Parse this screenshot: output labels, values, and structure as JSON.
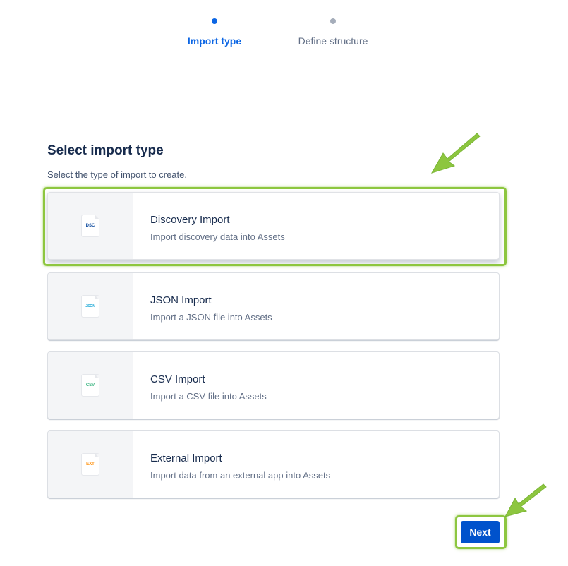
{
  "stepper": {
    "steps": [
      {
        "label": "Import type",
        "state": "active"
      },
      {
        "label": "Define structure",
        "state": "inactive"
      }
    ]
  },
  "header": {
    "title": "Select import type",
    "subtitle": "Select the type of import to create."
  },
  "import_types": [
    {
      "icon": "dsc-file-icon",
      "icon_text": "DSC",
      "icon_color": "#0c4a9e",
      "name": "Discovery Import",
      "description": "Import discovery data into Assets",
      "selected": true
    },
    {
      "icon": "json-file-icon",
      "icon_text": "JSON",
      "icon_color": "#1aa7d6",
      "name": "JSON Import",
      "description": "Import a JSON file into Assets",
      "selected": false
    },
    {
      "icon": "csv-file-icon",
      "icon_text": "CSV",
      "icon_color": "#36b37e",
      "name": "CSV Import",
      "description": "Import a CSV file into Assets",
      "selected": false
    },
    {
      "icon": "ext-file-icon",
      "icon_text": "EXT",
      "icon_color": "#ff8b00",
      "name": "External Import",
      "description": "Import data from an external app into Assets",
      "selected": false
    }
  ],
  "actions": {
    "next_label": "Next"
  },
  "colors": {
    "accent": "#0c66e4",
    "button": "#0052cc",
    "annotation_highlight": "#8dc63f"
  }
}
